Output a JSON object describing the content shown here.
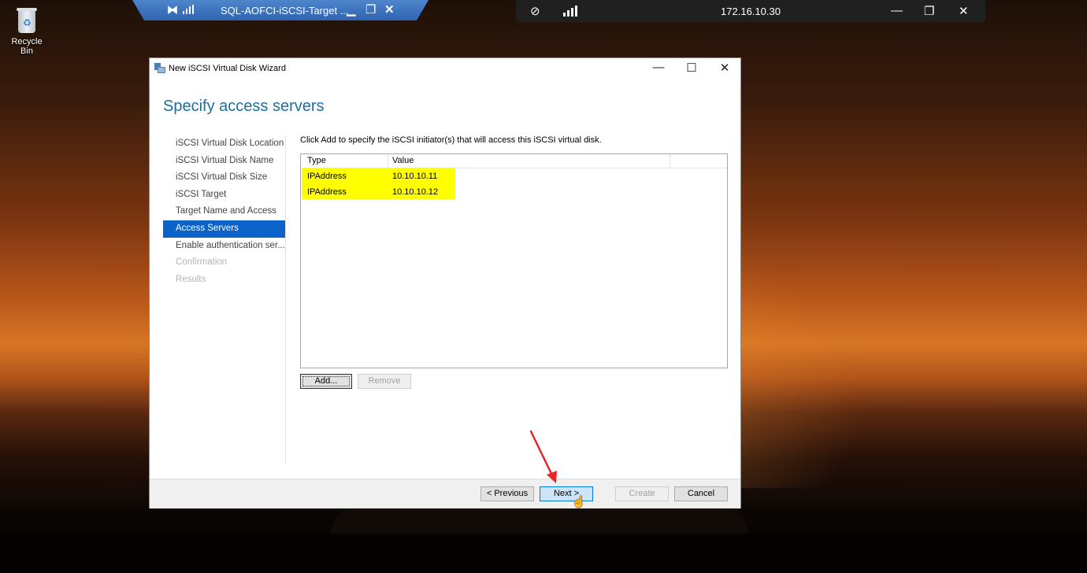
{
  "desktop": {
    "recycle_bin_label": "Recycle Bin"
  },
  "rdp_bar": {
    "title": "SQL-AOFCI-iSCSI-Target ..."
  },
  "remote_bar": {
    "ip": "172.16.10.30"
  },
  "window": {
    "title": "New iSCSI Virtual Disk Wizard",
    "heading": "Specify access servers"
  },
  "nav": {
    "items": [
      {
        "label": "iSCSI Virtual Disk Location"
      },
      {
        "label": "iSCSI Virtual Disk Name"
      },
      {
        "label": "iSCSI Virtual Disk Size"
      },
      {
        "label": "iSCSI Target"
      },
      {
        "label": "Target Name and Access"
      },
      {
        "label": "Access Servers"
      },
      {
        "label": "Enable authentication ser..."
      },
      {
        "label": "Confirmation"
      },
      {
        "label": "Results"
      }
    ]
  },
  "content": {
    "instruction": "Click Add to specify the iSCSI initiator(s) that will access this iSCSI virtual disk.",
    "columns": [
      "Type",
      "Value"
    ],
    "rows": [
      {
        "type": "IPAddress",
        "value": "10.10.10.11"
      },
      {
        "type": "IPAddress",
        "value": "10.10.10.12"
      }
    ],
    "add_label": "Add...",
    "remove_label": "Remove"
  },
  "footer": {
    "previous_label": "< Previous",
    "next_label": "Next >",
    "create_label": "Create",
    "cancel_label": "Cancel"
  },
  "colors": {
    "heading": "#1e6ea0",
    "nav_active": "#0b63c9",
    "highlight": "#ffff00",
    "annotation_arrow": "#e8262a"
  }
}
